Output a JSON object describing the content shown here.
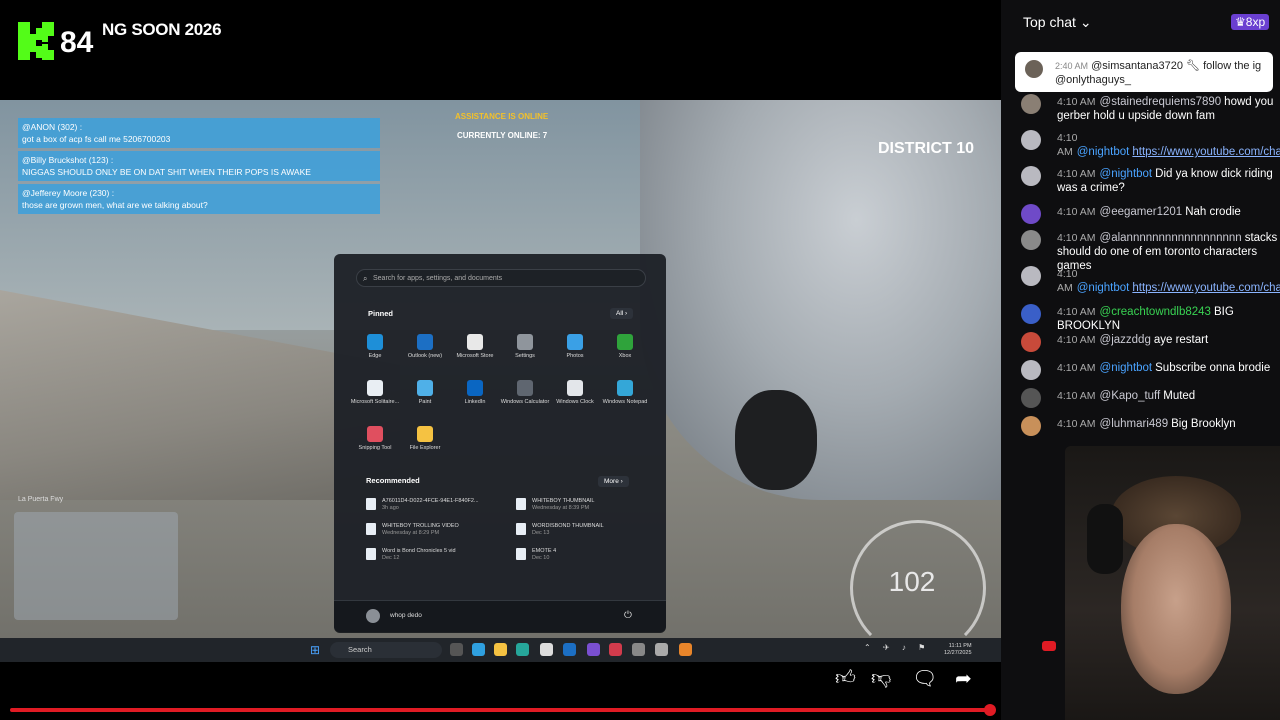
{
  "stream": {
    "viewer_count": "84",
    "ticker_text": "NG SOON 2026"
  },
  "game": {
    "overlay_messages": [
      {
        "author": "@ANON (302) :",
        "text": "got a box of acp fs call me 5206700203"
      },
      {
        "author": "@Billy Bruckshot (123) :",
        "text": "NIGGAS SHOULD ONLY BE ON DAT SHIT WHEN THEIR POPS IS AWAKE"
      },
      {
        "author": "@Jefferey Moore (230) :",
        "text": "those are grown men, what are we talking about?"
      }
    ],
    "assistance": "ASSISTANCE IS ONLINE",
    "online": "CURRENTLY ONLINE: 7",
    "district": "DISTRICT 10",
    "location": "La Puerta Fwy",
    "speed": "102",
    "colors": {
      "overlay_bg": "#3ca0dc",
      "assist": "#f3c12a"
    }
  },
  "start_menu": {
    "search_placeholder": "Search for apps, settings, and documents",
    "pinned_label": "Pinned",
    "all_label": "All",
    "apps": [
      {
        "label": "Edge",
        "icon": "edge-icon",
        "color": "#1e8fd8"
      },
      {
        "label": "Outlook (new)",
        "icon": "outlook-icon",
        "color": "#1c6fc4"
      },
      {
        "label": "Microsoft Store",
        "icon": "store-icon",
        "color": "#e8e8e8"
      },
      {
        "label": "Settings",
        "icon": "gear-icon",
        "color": "#8f959c"
      },
      {
        "label": "Photos",
        "icon": "photos-icon",
        "color": "#3aa0e6"
      },
      {
        "label": "Xbox",
        "icon": "xbox-icon",
        "color": "#2fa33b"
      },
      {
        "label": "Microsoft Solitaire...",
        "icon": "solitaire-icon",
        "color": "#e9eef3"
      },
      {
        "label": "Paint",
        "icon": "paint-icon",
        "color": "#4fb0e8"
      },
      {
        "label": "LinkedIn",
        "icon": "linkedin-icon",
        "color": "#0a66c2"
      },
      {
        "label": "Windows Calculator",
        "icon": "calculator-icon",
        "color": "#5f6670"
      },
      {
        "label": "Windows Clock",
        "icon": "clock-icon",
        "color": "#e3e6ea"
      },
      {
        "label": "Windows Notepad",
        "icon": "notepad-icon",
        "color": "#34a7d8"
      },
      {
        "label": "Snipping Tool",
        "icon": "snipping-icon",
        "color": "#e04f5f"
      },
      {
        "label": "File Explorer",
        "icon": "folder-icon",
        "color": "#f5c242"
      }
    ],
    "recommended_label": "Recommended",
    "more_label": "More",
    "recommended": [
      {
        "name": "A76011D4-D022-4FCE-94E1-F840F2...",
        "sub": "3h ago"
      },
      {
        "name": "WHITEBOY THUMBNAIL",
        "sub": "Wednesday at 8:39 PM"
      },
      {
        "name": "WHITEBOY TROLLING VIDEO",
        "sub": "Wednesday at 8:29 PM"
      },
      {
        "name": "WORDISBOND THUMBNAIL",
        "sub": "Dec 13"
      },
      {
        "name": "Word is Bond Chronicles 5 vid",
        "sub": "Dec 12"
      },
      {
        "name": "EMOTE 4",
        "sub": "Dec 10"
      }
    ],
    "user_name": "whop dedo"
  },
  "taskbar": {
    "search_label": "Search",
    "time": "11:11 PM",
    "date": "12/27/2025"
  },
  "chat": {
    "title": "Top chat",
    "xp": "8xp",
    "pinned": {
      "time": "2:40 AM",
      "user": "@simsantana3720",
      "text": "follow the ig @onlythaguys_"
    },
    "messages": [
      {
        "time": "4:10 AM",
        "user": "@stainedrequiems7890",
        "text": "howd you gerber hold u upside down fam",
        "style": "normal"
      },
      {
        "time": "4:10 AM",
        "user": "@nightbot",
        "text": "https://www.youtube.com/channel/UCYJV...",
        "style": "link"
      },
      {
        "time": "4:10 AM",
        "user": "@nightbot",
        "text": "Did ya know dick riding was a crime?",
        "style": "normal"
      },
      {
        "time": "4:10 AM",
        "user": "@eegamer1201",
        "text": "Nah crodie",
        "style": "normal"
      },
      {
        "time": "4:10 AM",
        "user": "@alannnnnnnnnnnnnnnnnn",
        "text": "stacks should do one of em toronto characters games",
        "style": "normal"
      },
      {
        "time": "4:10 AM",
        "user": "@nightbot",
        "text": "https://www.youtube.com/channel/UCYJV...",
        "style": "link"
      },
      {
        "time": "4:10 AM",
        "user": "@creachtowndlb8243",
        "text": "BIG BROOKLYN",
        "style": "green"
      },
      {
        "time": "4:10 AM",
        "user": "@jazzddg",
        "text": "aye restart",
        "style": "normal"
      },
      {
        "time": "4:10 AM",
        "user": "@nightbot",
        "text": "Subscribe onna brodie",
        "style": "normal"
      },
      {
        "time": "4:10 AM",
        "user": "@Kapo_tuff",
        "text": "Muted",
        "style": "normal"
      },
      {
        "time": "4:10 AM",
        "user": "@luhmari489",
        "text": "Big Brooklyn",
        "style": "normal"
      }
    ]
  }
}
